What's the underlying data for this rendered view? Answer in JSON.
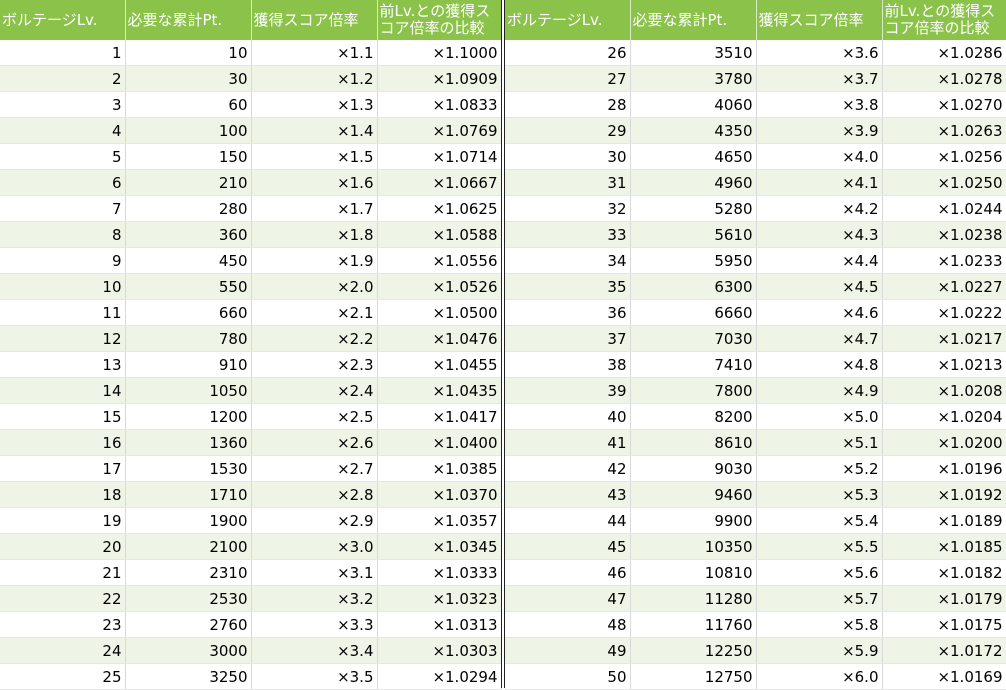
{
  "headers": [
    "ボルテージLv.",
    "必要な累計Pt.",
    "獲得スコア倍率",
    "前Lv.との獲得スコア倍率の比較"
  ],
  "left_rows": [
    [
      "1",
      "10",
      "×1.1",
      "×1.1000"
    ],
    [
      "2",
      "30",
      "×1.2",
      "×1.0909"
    ],
    [
      "3",
      "60",
      "×1.3",
      "×1.0833"
    ],
    [
      "4",
      "100",
      "×1.4",
      "×1.0769"
    ],
    [
      "5",
      "150",
      "×1.5",
      "×1.0714"
    ],
    [
      "6",
      "210",
      "×1.6",
      "×1.0667"
    ],
    [
      "7",
      "280",
      "×1.7",
      "×1.0625"
    ],
    [
      "8",
      "360",
      "×1.8",
      "×1.0588"
    ],
    [
      "9",
      "450",
      "×1.9",
      "×1.0556"
    ],
    [
      "10",
      "550",
      "×2.0",
      "×1.0526"
    ],
    [
      "11",
      "660",
      "×2.1",
      "×1.0500"
    ],
    [
      "12",
      "780",
      "×2.2",
      "×1.0476"
    ],
    [
      "13",
      "910",
      "×2.3",
      "×1.0455"
    ],
    [
      "14",
      "1050",
      "×2.4",
      "×1.0435"
    ],
    [
      "15",
      "1200",
      "×2.5",
      "×1.0417"
    ],
    [
      "16",
      "1360",
      "×2.6",
      "×1.0400"
    ],
    [
      "17",
      "1530",
      "×2.7",
      "×1.0385"
    ],
    [
      "18",
      "1710",
      "×2.8",
      "×1.0370"
    ],
    [
      "19",
      "1900",
      "×2.9",
      "×1.0357"
    ],
    [
      "20",
      "2100",
      "×3.0",
      "×1.0345"
    ],
    [
      "21",
      "2310",
      "×3.1",
      "×1.0333"
    ],
    [
      "22",
      "2530",
      "×3.2",
      "×1.0323"
    ],
    [
      "23",
      "2760",
      "×3.3",
      "×1.0313"
    ],
    [
      "24",
      "3000",
      "×3.4",
      "×1.0303"
    ],
    [
      "25",
      "3250",
      "×3.5",
      "×1.0294"
    ]
  ],
  "right_rows": [
    [
      "26",
      "3510",
      "×3.6",
      "×1.0286"
    ],
    [
      "27",
      "3780",
      "×3.7",
      "×1.0278"
    ],
    [
      "28",
      "4060",
      "×3.8",
      "×1.0270"
    ],
    [
      "29",
      "4350",
      "×3.9",
      "×1.0263"
    ],
    [
      "30",
      "4650",
      "×4.0",
      "×1.0256"
    ],
    [
      "31",
      "4960",
      "×4.1",
      "×1.0250"
    ],
    [
      "32",
      "5280",
      "×4.2",
      "×1.0244"
    ],
    [
      "33",
      "5610",
      "×4.3",
      "×1.0238"
    ],
    [
      "34",
      "5950",
      "×4.4",
      "×1.0233"
    ],
    [
      "35",
      "6300",
      "×4.5",
      "×1.0227"
    ],
    [
      "36",
      "6660",
      "×4.6",
      "×1.0222"
    ],
    [
      "37",
      "7030",
      "×4.7",
      "×1.0217"
    ],
    [
      "38",
      "7410",
      "×4.8",
      "×1.0213"
    ],
    [
      "39",
      "7800",
      "×4.9",
      "×1.0208"
    ],
    [
      "40",
      "8200",
      "×5.0",
      "×1.0204"
    ],
    [
      "41",
      "8610",
      "×5.1",
      "×1.0200"
    ],
    [
      "42",
      "9030",
      "×5.2",
      "×1.0196"
    ],
    [
      "43",
      "9460",
      "×5.3",
      "×1.0192"
    ],
    [
      "44",
      "9900",
      "×5.4",
      "×1.0189"
    ],
    [
      "45",
      "10350",
      "×5.5",
      "×1.0185"
    ],
    [
      "46",
      "10810",
      "×5.6",
      "×1.0182"
    ],
    [
      "47",
      "11280",
      "×5.7",
      "×1.0179"
    ],
    [
      "48",
      "11760",
      "×5.8",
      "×1.0175"
    ],
    [
      "49",
      "12250",
      "×5.9",
      "×1.0172"
    ],
    [
      "50",
      "12750",
      "×6.0",
      "×1.0169"
    ]
  ],
  "colors": {
    "header_bg": "#8bc34a",
    "alt_row_bg": "#eef5e6"
  }
}
